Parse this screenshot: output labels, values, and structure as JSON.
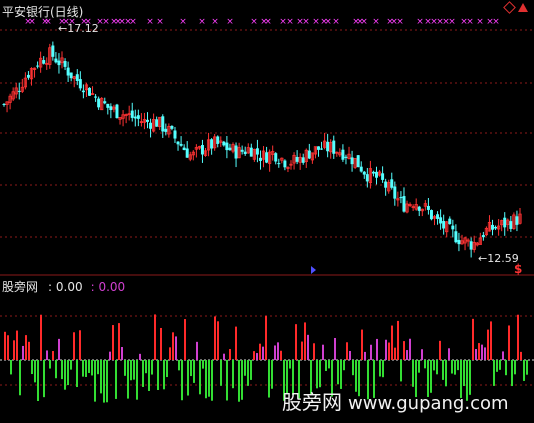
{
  "window": {
    "title": "平安银行(日线)",
    "sub_indicator_name": "股旁网",
    "sub_value1": ": 0.00",
    "sub_value2": ": 0.00",
    "high_label": "17.12",
    "low_label": "12.59",
    "dollar_marker": "$",
    "watermark_text": "股旁网",
    "watermark_url": "www.gupang.com"
  },
  "colors": {
    "background": "#000000",
    "grid": "#8b1a1a",
    "up_candle": "#ff3333",
    "down_candle": "#54ffff",
    "hist_green": "#33dd33",
    "hist_red": "#ff2a2a",
    "hist_magenta": "#d040d0",
    "signal_x": "#ff40ff"
  },
  "icons": [
    "diamond-icon",
    "up-triangle-icon",
    "signal-x-markers"
  ],
  "chart_data": [
    {
      "type": "candlestick",
      "title": "平安银行(日线)",
      "period": "daily",
      "price_high": 17.12,
      "price_low": 12.59,
      "ylim": [
        12.3,
        17.6
      ],
      "approx_close_path": [
        15.9,
        16.2,
        16.6,
        16.9,
        17.05,
        16.8,
        16.5,
        16.3,
        16.0,
        15.8,
        15.7,
        15.6,
        15.5,
        15.5,
        15.3,
        15.0,
        14.7,
        14.9,
        15.0,
        14.9,
        14.8,
        14.9,
        14.7,
        14.8,
        14.6,
        14.6,
        14.8,
        14.9,
        14.9,
        14.8,
        14.6,
        14.3,
        14.2,
        13.9,
        13.6,
        13.7,
        13.5,
        13.2,
        13.0,
        12.8,
        12.7,
        13.0,
        13.1,
        13.2,
        13.3
      ]
    },
    {
      "type": "bar",
      "title": "股旁网",
      "values_shown": [
        0.0,
        0.0
      ]
    }
  ]
}
